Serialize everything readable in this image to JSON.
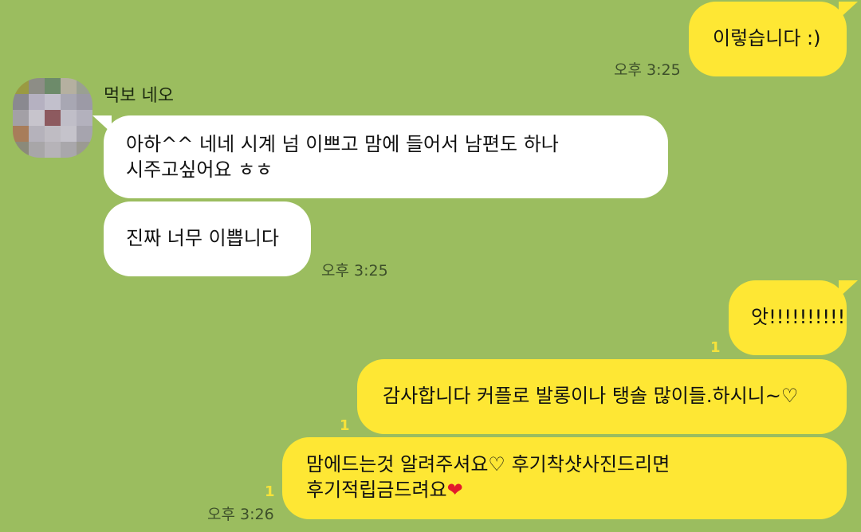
{
  "chat": {
    "messages": [
      {
        "id": "m1",
        "side": "mine",
        "text": "이렇습니다 :)",
        "time": "오후 3:25"
      },
      {
        "id": "m2",
        "side": "theirs",
        "sender": "먹보 네오",
        "lines": [
          "아하^^ 네네 시계 넘 이쁘고 맘에 들어서 남편도 하나",
          "시주고싶어요 ㅎㅎ"
        ]
      },
      {
        "id": "m3",
        "side": "theirs",
        "text": "진짜 너무 이쁩니다",
        "time": "오후 3:25"
      },
      {
        "id": "m4",
        "side": "mine",
        "text": "앗!!!!!!!!!!",
        "unread": "1"
      },
      {
        "id": "m5",
        "side": "mine",
        "text": "감사합니다 커플로 발롱이나 탱솔 많이들.하시니~♡",
        "unread": "1"
      },
      {
        "id": "m6",
        "side": "mine",
        "lines": [
          "맘에드는것 알려주셔요♡ 후기착샷사진드리면",
          "후기적립금드려요"
        ],
        "emoji": "❤",
        "unread": "1",
        "time": "오후 3:26"
      }
    ],
    "sender_name": "먹보 네오"
  },
  "colors": {
    "background": "#9bbd5f",
    "my_bubble": "#fee734",
    "their_bubble": "#ffffff",
    "unread": "#f6e23a",
    "heart": "#e21b2b"
  },
  "icons": {
    "avatar": "blurred-profile-avatar",
    "heart": "red-heart-emoji"
  }
}
